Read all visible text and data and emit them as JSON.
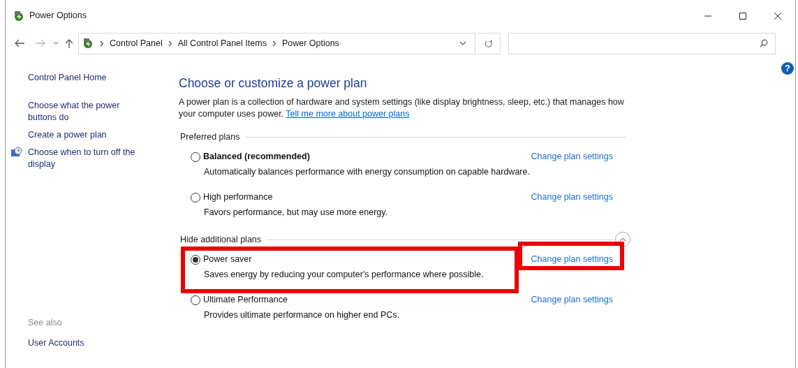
{
  "window": {
    "title": "Power Options"
  },
  "address_bar": {
    "breadcrumbs": [
      "Control Panel",
      "All Control Panel Items",
      "Power Options"
    ]
  },
  "help_button": {
    "label": "?"
  },
  "sidebar": {
    "items": [
      {
        "label": "Control Panel Home",
        "icon": false
      },
      {
        "label": "Choose what the power buttons do",
        "icon": false
      },
      {
        "label": "Create a power plan",
        "icon": false
      },
      {
        "label": "Choose when to turn off the display",
        "icon": true
      }
    ],
    "see_also": {
      "heading": "See also",
      "items": [
        "User Accounts"
      ]
    }
  },
  "main": {
    "title": "Choose or customize a power plan",
    "intro": "A power plan is a collection of hardware and system settings (like display brightness, sleep, etc.) that manages how your computer uses power.",
    "intro_link": "Tell me more about power plans",
    "groups": [
      {
        "heading": "Preferred plans",
        "collapse_button": false,
        "plans": [
          {
            "name": "Balanced (recommended)",
            "bold": true,
            "selected": false,
            "highlighted": false,
            "description": "Automatically balances performance with energy consumption on capable hardware.",
            "link": "Change plan settings"
          },
          {
            "name": "High performance",
            "bold": false,
            "selected": false,
            "highlighted": false,
            "description": "Favors performance, but may use more energy.",
            "link": "Change plan settings"
          }
        ]
      },
      {
        "heading": "Hide additional plans",
        "collapse_button": true,
        "plans": [
          {
            "name": "Power saver",
            "bold": false,
            "selected": true,
            "highlighted": true,
            "description": "Saves energy by reducing your computer's performance where possible.",
            "link": "Change plan settings"
          },
          {
            "name": "Ultimate Performance",
            "bold": false,
            "selected": false,
            "highlighted": false,
            "description": "Provides ultimate performance on higher end PCs.",
            "link": "Change plan settings"
          }
        ]
      }
    ]
  }
}
